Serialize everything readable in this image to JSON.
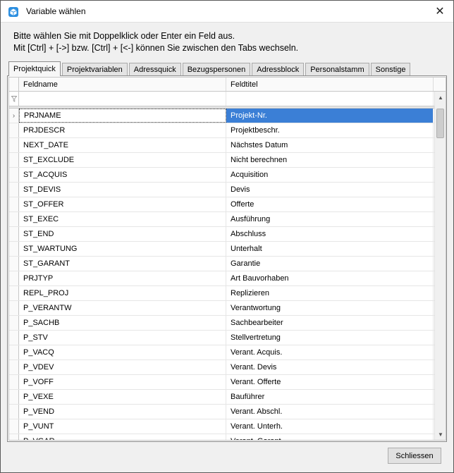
{
  "window": {
    "title": "Variable wählen",
    "close_glyph": "✕"
  },
  "instructions": {
    "line1": "Bitte wählen Sie mit Doppelklick oder Enter ein Feld aus.",
    "line2": "Mit [Ctrl] + [->] bzw. [Ctrl] + [<-] können Sie zwischen den Tabs wechseln."
  },
  "tabs": [
    {
      "label": "Projektquick",
      "active": true
    },
    {
      "label": "Projektvariablen",
      "active": false
    },
    {
      "label": "Adressquick",
      "active": false
    },
    {
      "label": "Bezugspersonen",
      "active": false
    },
    {
      "label": "Adressblock",
      "active": false
    },
    {
      "label": "Personalstamm",
      "active": false
    },
    {
      "label": "Sonstige",
      "active": false
    }
  ],
  "grid": {
    "columns": [
      "Feldname",
      "Feldtitel"
    ],
    "selected_index": 0,
    "rows": [
      {
        "name": "PRJNAME",
        "title": "Projekt-Nr."
      },
      {
        "name": "PRJDESCR",
        "title": "Projektbeschr."
      },
      {
        "name": "NEXT_DATE",
        "title": "Nächstes Datum"
      },
      {
        "name": "ST_EXCLUDE",
        "title": "Nicht berechnen"
      },
      {
        "name": "ST_ACQUIS",
        "title": "Acquisition"
      },
      {
        "name": "ST_DEVIS",
        "title": "Devis"
      },
      {
        "name": "ST_OFFER",
        "title": "Offerte"
      },
      {
        "name": "ST_EXEC",
        "title": "Ausführung"
      },
      {
        "name": "ST_END",
        "title": "Abschluss"
      },
      {
        "name": "ST_WARTUNG",
        "title": "Unterhalt"
      },
      {
        "name": "ST_GARANT",
        "title": "Garantie"
      },
      {
        "name": "PRJTYP",
        "title": "Art Bauvorhaben"
      },
      {
        "name": "REPL_PROJ",
        "title": "Replizieren"
      },
      {
        "name": "P_VERANTW",
        "title": "Verantwortung"
      },
      {
        "name": "P_SACHB",
        "title": "Sachbearbeiter"
      },
      {
        "name": "P_STV",
        "title": "Stellvertretung"
      },
      {
        "name": "P_VACQ",
        "title": "Verant. Acquis."
      },
      {
        "name": "P_VDEV",
        "title": "Verant. Devis"
      },
      {
        "name": "P_VOFF",
        "title": "Verant. Offerte"
      },
      {
        "name": "P_VEXE",
        "title": "Bauführer"
      },
      {
        "name": "P_VEND",
        "title": "Verant. Abschl."
      },
      {
        "name": "P_VUNT",
        "title": "Verant. Unterh."
      },
      {
        "name": "P_VGAR",
        "title": "Verant. Garant."
      }
    ]
  },
  "buttons": {
    "close_label": "Schliessen"
  }
}
